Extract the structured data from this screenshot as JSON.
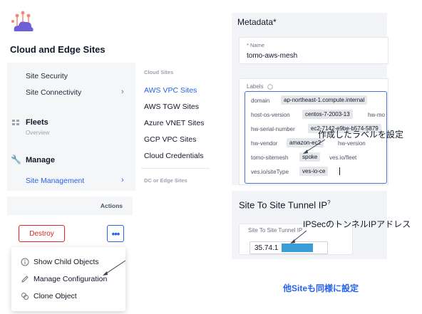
{
  "app": {
    "title": "Cloud and Edge Sites"
  },
  "nav": {
    "site_security": "Site Security",
    "site_connectivity": "Site Connectivity",
    "fleets": "Fleets",
    "fleets_sub": "Overview",
    "manage": "Manage",
    "site_management": "Site Management"
  },
  "menu": {
    "cloud_sites_header": "Cloud Sites",
    "items": [
      "AWS VPC Sites",
      "AWS TGW Sites",
      "Azure VNET Sites",
      "GCP VPC Sites",
      "Cloud Credentials"
    ],
    "dc_edge_header": "DC or Edge Sites"
  },
  "actions": {
    "header": "Actions",
    "destroy": "Destroy",
    "more": "•••",
    "context_menu": [
      "Show Child Objects",
      "Manage Configuration",
      "Clone Object"
    ]
  },
  "metadata": {
    "title": "Metadata",
    "required_mark": "*",
    "name_label": "* Name",
    "name_value": "tomo-aws-mesh",
    "labels_title": "Labels",
    "labels": [
      {
        "key": "domain",
        "value": "ap-northeast-1.compute.internal"
      },
      {
        "key": "host-os-version",
        "value": "centos-7-2003-13"
      },
      {
        "key": "hw-mo",
        "value": ""
      },
      {
        "key": "hw-serial-number",
        "value": "ec2-7142-e9be-b574-5879"
      },
      {
        "key": "hw-vendor",
        "value": "amazon-ec2"
      },
      {
        "key": "hw-version",
        "value": ""
      },
      {
        "key": "tomo-sitemesh",
        "value": "spoke"
      },
      {
        "key": "ves.io/fleet",
        "value": ""
      },
      {
        "key": "ves.io/siteType",
        "value": "ves-io-ce"
      }
    ]
  },
  "annotations": {
    "labels_note": "作成したラベルを設定",
    "ipsec_note": "IPSecのトンネルIPアドレス",
    "other_sites_note": "他Siteも同様に設定"
  },
  "tunnel": {
    "title": "Site To Site Tunnel IP",
    "help_mark": "?",
    "field_label": "Site To Site Tunnel IP",
    "value": "35.74.1"
  },
  "colors": {
    "accent": "#2563eb",
    "danger": "#dc2626",
    "redaction": "#3b9dd8"
  }
}
